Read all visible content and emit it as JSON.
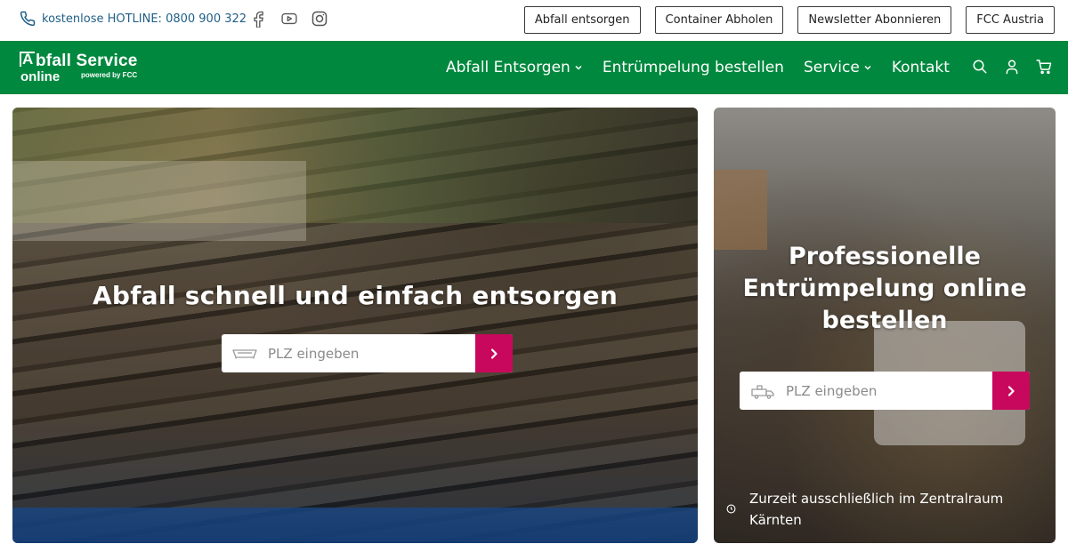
{
  "topbar": {
    "hotline": "kostenlose HOTLINE: 0800 900 322",
    "social_icons": [
      "facebook-icon",
      "youtube-icon",
      "instagram-icon"
    ],
    "buttons": [
      "Abfall entsorgen",
      "Container Abholen",
      "Newsletter Abonnieren",
      "FCC Austria"
    ]
  },
  "logo": {
    "line1_rest": "bfall Service",
    "line1_box_letter": "A",
    "line2": "online",
    "line3": "powered by FCC"
  },
  "nav": {
    "items": [
      {
        "label": "Abfall Entsorgen",
        "dropdown": true
      },
      {
        "label": "Entrümpelung bestellen",
        "dropdown": false
      },
      {
        "label": "Service",
        "dropdown": true
      },
      {
        "label": "Kontakt",
        "dropdown": false
      }
    ],
    "icons": [
      "search-icon",
      "user-icon",
      "cart-icon"
    ]
  },
  "hero_left": {
    "title": "Abfall schnell und einfach entsorgen",
    "placeholder": "PLZ eingeben"
  },
  "hero_right": {
    "title": "Professionelle Entrümpelung online bestellen",
    "placeholder": "PLZ eingeben",
    "notice": "Zurzeit ausschließlich im Zentralraum Kärnten"
  },
  "colors": {
    "brand_green": "#00883e",
    "accent_magenta": "#c8085c",
    "link_blue": "#1f5f86"
  }
}
